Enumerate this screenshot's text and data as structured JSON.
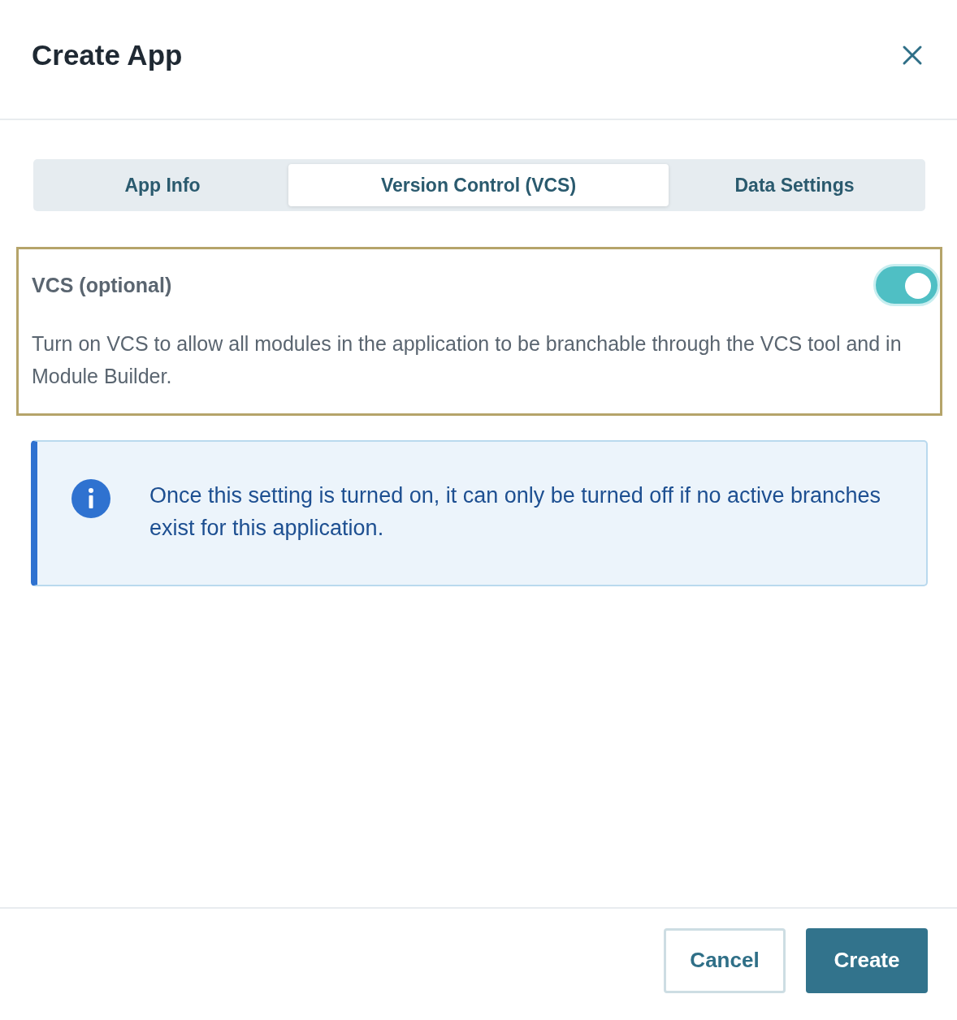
{
  "dialog": {
    "title": "Create App"
  },
  "tabs": [
    {
      "label": "App Info",
      "selected": false
    },
    {
      "label": "Version Control (VCS)",
      "selected": true
    },
    {
      "label": "Data Settings",
      "selected": false
    }
  ],
  "vcs": {
    "label": "VCS (optional)",
    "on": true,
    "description": "Turn on VCS to allow all modules in the application to be branchable through the VCS tool and in Module Builder."
  },
  "notice": {
    "text": "Once this setting is turned on, it can only be turned off if no active branches exist for this application."
  },
  "buttons": [
    {
      "label": "Cancel",
      "kind": "secondary"
    },
    {
      "label": "Create",
      "kind": "primary"
    }
  ]
}
